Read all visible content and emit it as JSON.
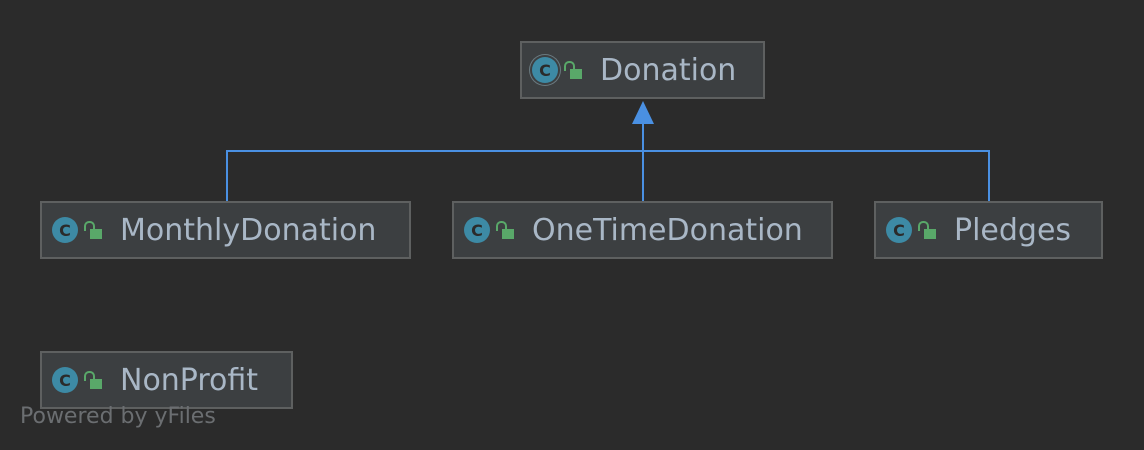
{
  "colors": {
    "background": "#2b2b2b",
    "node_fill": "#3c3f41",
    "node_border": "#5e6060",
    "text": "#a9b7c6",
    "class_icon": "#3d8aa5",
    "access_icon": "#59a869",
    "inheritance_edge": "#4a90e2"
  },
  "icons": {
    "class": "class-icon",
    "access": "public-lock-icon"
  },
  "nodes": {
    "donation": {
      "label": "Donation",
      "icon_letter": "C",
      "abstract": true
    },
    "monthly": {
      "label": "MonthlyDonation",
      "icon_letter": "C"
    },
    "onetime": {
      "label": "OneTimeDonation",
      "icon_letter": "C"
    },
    "pledges": {
      "label": "Pledges",
      "icon_letter": "C"
    },
    "nonprofit": {
      "label": "NonProfit",
      "icon_letter": "C"
    }
  },
  "edges": [
    {
      "from": "MonthlyDonation",
      "to": "Donation",
      "type": "inheritance"
    },
    {
      "from": "OneTimeDonation",
      "to": "Donation",
      "type": "inheritance"
    },
    {
      "from": "Pledges",
      "to": "Donation",
      "type": "inheritance"
    }
  ],
  "footer": "Powered by yFiles"
}
